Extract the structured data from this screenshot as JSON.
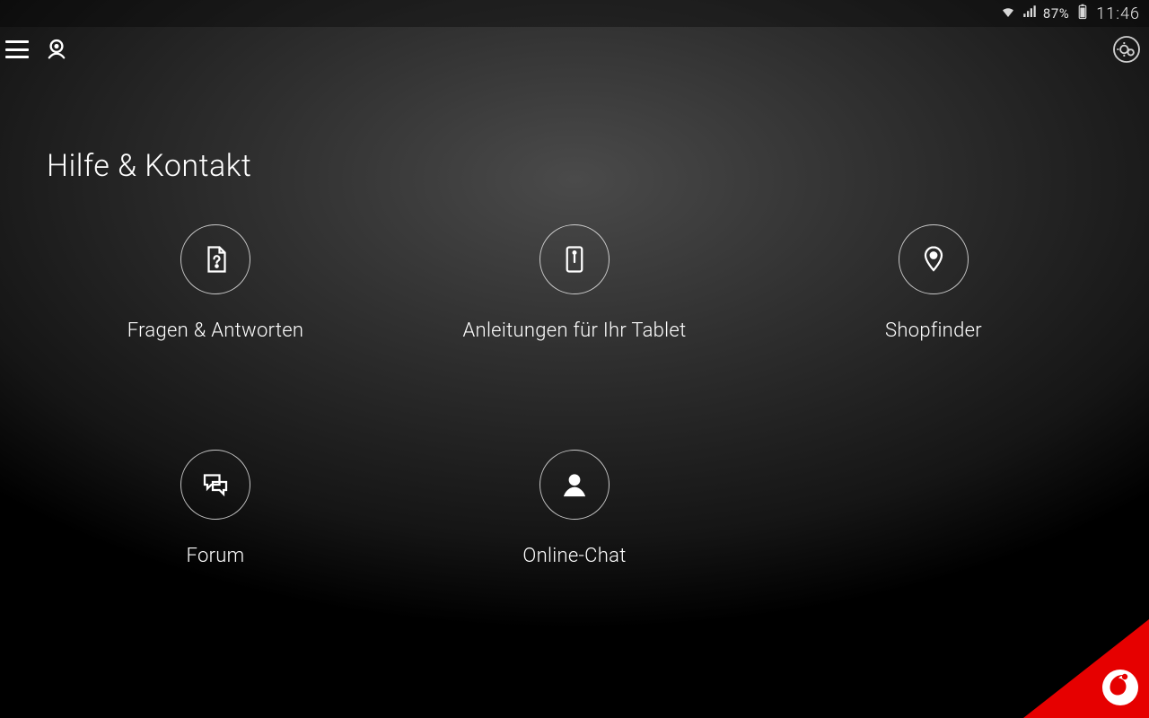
{
  "status": {
    "battery_pct": "87%",
    "clock": "11:46"
  },
  "page": {
    "title": "Hilfe & Kontakt"
  },
  "tiles": {
    "faq": {
      "label": "Fragen & Antworten"
    },
    "guides": {
      "label": "Anleitungen für Ihr Tablet"
    },
    "shopfinder": {
      "label": "Shopfinder"
    },
    "forum": {
      "label": "Forum"
    },
    "chat": {
      "label": "Online-Chat"
    }
  }
}
